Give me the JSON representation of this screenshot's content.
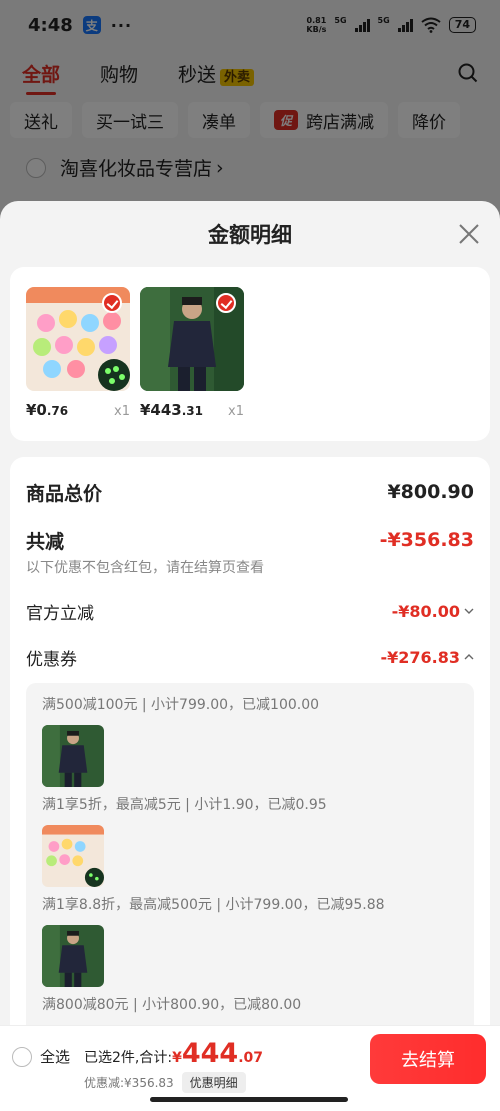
{
  "status": {
    "time": "4:48",
    "app_badge": "支",
    "dots": "···",
    "net_speed": "0.81",
    "net_unit": "KB/s",
    "sig1": "5G",
    "sig2": "5G",
    "battery": "74"
  },
  "tabs": {
    "all": "全部",
    "shopping": "购物",
    "instant": "秒送",
    "takeout": "外卖"
  },
  "chips": [
    "送礼",
    "买一试三",
    "凑单",
    "跨店满减",
    "降价"
  ],
  "chip_icon": "促",
  "shop": {
    "name": "淘喜化妆品专营店",
    "arrow": "›"
  },
  "sheet": {
    "title": "金额明细"
  },
  "products": [
    {
      "price_int": "¥0",
      "price_dec": ".76",
      "qty": "x1"
    },
    {
      "price_int": "¥443",
      "price_dec": ".31",
      "qty": "x1"
    }
  ],
  "summary": {
    "total_label": "商品总价",
    "total_value": "¥800.90",
    "reduce_label": "共减",
    "reduce_value": "-¥356.83",
    "hint": "以下优惠不包含红包，请在结算页查看",
    "official_label": "官方立减",
    "official_value": "-¥80.00",
    "coupon_label": "优惠券",
    "coupon_value": "-¥276.83"
  },
  "coupons": [
    "满500减100元 | 小计799.00，已减100.00",
    "满1享5折，最高减5元 | 小计1.90，已减0.95",
    "满1享8.8折，最高减500元 | 小计799.00，已减95.88",
    "满800减80元 | 小计800.90，已减80.00"
  ],
  "bottom": {
    "select_all": "全选",
    "selected": "已选2件,合计:",
    "yen": "¥",
    "amount": "444",
    "cents": ".07",
    "discount": "优惠减:¥356.83",
    "detail": "优惠明细",
    "checkout": "去结算"
  },
  "colors": {
    "accent": "#e02e24",
    "checkout": "#ff2d2d"
  },
  "icons": [
    "search-icon",
    "close-icon",
    "check-icon",
    "chevron-down-icon",
    "chevron-up-icon",
    "radio-icon"
  ]
}
